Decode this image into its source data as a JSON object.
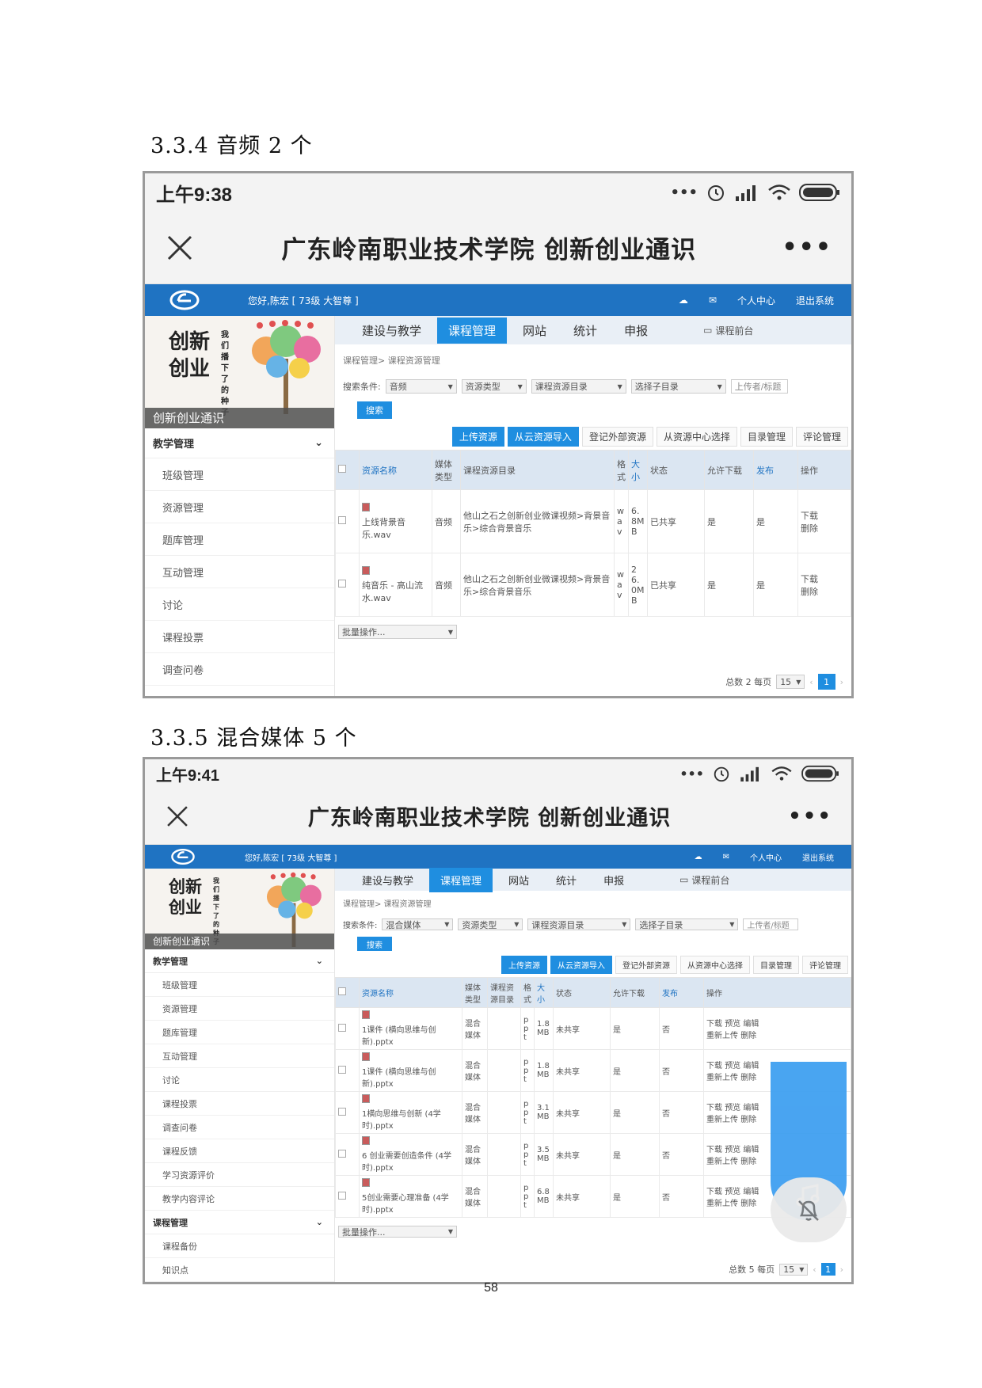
{
  "headings": {
    "audio": "3.3.4 音频 2 个",
    "mixed": "3.3.5 混合媒体 5 个"
  },
  "page_number": "58",
  "common": {
    "app_title": "广东岭南职业技术学院 创新创业通识",
    "more": "•••",
    "greeting": "您好,陈宏 [ 73级 大智尊 ]",
    "personal_center": "个人中心",
    "logout": "退出系统",
    "banner_caption": "创新创业通识",
    "banner_calligraphy": "创新 创业",
    "banner_small": "我们播下了的种子",
    "tabs": [
      "建设与教学",
      "课程管理",
      "网站",
      "统计",
      "申报"
    ],
    "front_link": "课程前台",
    "breadcrumb": "课程管理> 课程资源管理",
    "search_label": "搜索条件:",
    "selects": [
      "资源类型",
      "课程资源目录",
      "选择子目录"
    ],
    "uploader_placeholder": "上传者/标题",
    "search_button": "搜索",
    "action_buttons": [
      "上传资源",
      "从云资源导入",
      "登记外部资源",
      "从资源中心选择",
      "目录管理",
      "评论管理"
    ],
    "batch": "批量操作...",
    "page_size": "15",
    "current_page": "1",
    "icons": {
      "close": "close-icon",
      "alarm": "alarm-icon",
      "signal": "signal-icon",
      "wifi": "wifi-icon",
      "battery": "battery-icon",
      "music": "music-note-icon",
      "bell_off": "bell-off-icon"
    },
    "colors": {
      "brand": "#1f73c2",
      "accent": "#1f8ee0",
      "size_red": "#d04040"
    }
  },
  "shot1": {
    "time": "上午9:38",
    "menu_section": "教学管理",
    "menu": [
      "班级管理",
      "资源管理",
      "题库管理",
      "互动管理",
      "讨论",
      "课程投票",
      "调查问卷"
    ],
    "search_value": "音频",
    "headers": [
      "资源名称",
      "媒体类型",
      "课程资源目录",
      "格式",
      "大小",
      "状态",
      "允许下载",
      "发布",
      "操作"
    ],
    "rows": [
      {
        "name": "上线背景音乐.wav",
        "type": "音频",
        "dir": "他山之石之创新创业微课视频>背景音乐>综合背景音乐",
        "fmt": "wav",
        "size": "6.8MB",
        "status": "已共享",
        "download": "是",
        "publish": "是",
        "ops": [
          "下载",
          "删除"
        ]
      },
      {
        "name": "纯音乐 - 高山流水.wav",
        "type": "音频",
        "dir": "他山之石之创新创业微课视频>背景音乐>综合背景音乐",
        "fmt": "wav",
        "size": "26.0MB",
        "status": "已共享",
        "download": "是",
        "publish": "是",
        "ops": [
          "下载",
          "删除"
        ]
      }
    ],
    "total": "总数 2 每页"
  },
  "shot2": {
    "time": "上午9:41",
    "menu_section": "教学管理",
    "menu": [
      "班级管理",
      "资源管理",
      "题库管理",
      "互动管理",
      "讨论",
      "课程投票",
      "调查问卷",
      "课程反馈",
      "学习资源评价",
      "教学内容评论"
    ],
    "menu_section2": "课程管理",
    "menu2": [
      "课程备份",
      "知识点"
    ],
    "search_value": "混合媒体",
    "headers": [
      "资源名称",
      "媒体类型",
      "课程资源目录",
      "格式",
      "大小",
      "状态",
      "允许下载",
      "发布",
      "操作"
    ],
    "rows": [
      {
        "name": "1课件 (横向思维与创新).pptx",
        "type": "混合媒体",
        "fmt": "ppt",
        "size": "1.8MB",
        "status": "未共享",
        "download": "是",
        "publish": "否",
        "ops": [
          "下载",
          "预览",
          "编辑",
          "重新上传",
          "删除"
        ]
      },
      {
        "name": "1课件 (横向思维与创新).pptx",
        "type": "混合媒体",
        "fmt": "ppt",
        "size": "1.8MB",
        "status": "未共享",
        "download": "是",
        "publish": "否",
        "ops": [
          "下载",
          "预览",
          "编辑",
          "重新上传",
          "删除"
        ]
      },
      {
        "name": "1横向思维与创新 (4学时).pptx",
        "type": "混合媒体",
        "fmt": "ppt",
        "size": "3.1MB",
        "status": "未共享",
        "download": "是",
        "publish": "否",
        "ops": [
          "下载",
          "预览",
          "编辑",
          "重新上传",
          "删除"
        ]
      },
      {
        "name": "6 创业需要创造条件 (4学时).pptx",
        "type": "混合媒体",
        "fmt": "ppt",
        "size": "3.5MB",
        "status": "未共享",
        "download": "是",
        "publish": "否",
        "ops": [
          "下载",
          "预览",
          "编辑",
          "重新上传",
          "删除"
        ]
      },
      {
        "name": "5创业需要心理准备 (4学时).pptx",
        "type": "混合媒体",
        "fmt": "ppt",
        "size": "6.8MB",
        "status": "未共享",
        "download": "是",
        "publish": "否",
        "ops": [
          "下载",
          "预览",
          "编辑",
          "重新上传",
          "删除"
        ]
      }
    ],
    "total": "总数 5 每页"
  }
}
